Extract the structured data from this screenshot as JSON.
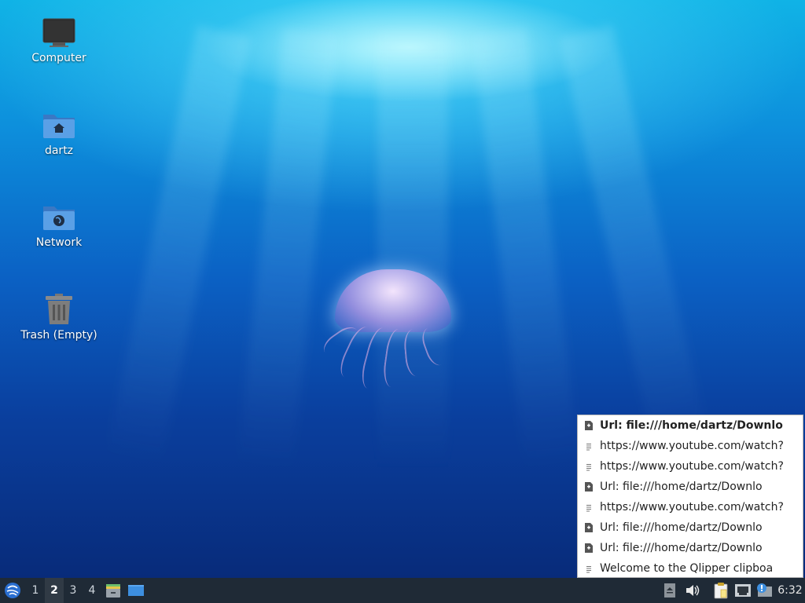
{
  "desktop": {
    "icons": [
      {
        "label": "Computer",
        "icon": "computer-monitor-icon"
      },
      {
        "label": "dartz",
        "icon": "home-folder-icon"
      },
      {
        "label": "Network",
        "icon": "network-folder-icon"
      },
      {
        "label": "Trash (Empty)",
        "icon": "trash-icon"
      }
    ]
  },
  "clipboard_menu": {
    "items": [
      {
        "text": "Url: file:///home/dartz/Downlo",
        "icon": "url-file-icon",
        "current": true
      },
      {
        "text": "https://www.youtube.com/watch?",
        "icon": "text-doc-icon"
      },
      {
        "text": "https://www.youtube.com/watch?",
        "icon": "text-doc-icon"
      },
      {
        "text": "Url: file:///home/dartz/Downlo",
        "icon": "url-file-icon"
      },
      {
        "text": "https://www.youtube.com/watch?",
        "icon": "text-doc-icon"
      },
      {
        "text": "Url: file:///home/dartz/Downlo",
        "icon": "url-file-icon"
      },
      {
        "text": "Url: file:///home/dartz/Downlo",
        "icon": "url-file-icon"
      },
      {
        "text": "Welcome to the Qlipper clipboa",
        "icon": "text-doc-icon"
      }
    ]
  },
  "taskbar": {
    "start_icon": "lubuntu-start-menu-icon",
    "workspaces": [
      "1",
      "2",
      "3",
      "4"
    ],
    "active_workspace": "2",
    "launchers": [
      "file-manager-icon",
      "show-desktop-icon"
    ],
    "tray": [
      "eject-icon",
      "volume-icon",
      "clipboard-icon",
      "network-wired-icon",
      "update-notifier-icon"
    ],
    "clock": "6:32"
  },
  "colors": {
    "taskbar_bg": "#1f2a36",
    "menu_bg": "#ffffff",
    "folder_blue": "#4a90d9"
  }
}
